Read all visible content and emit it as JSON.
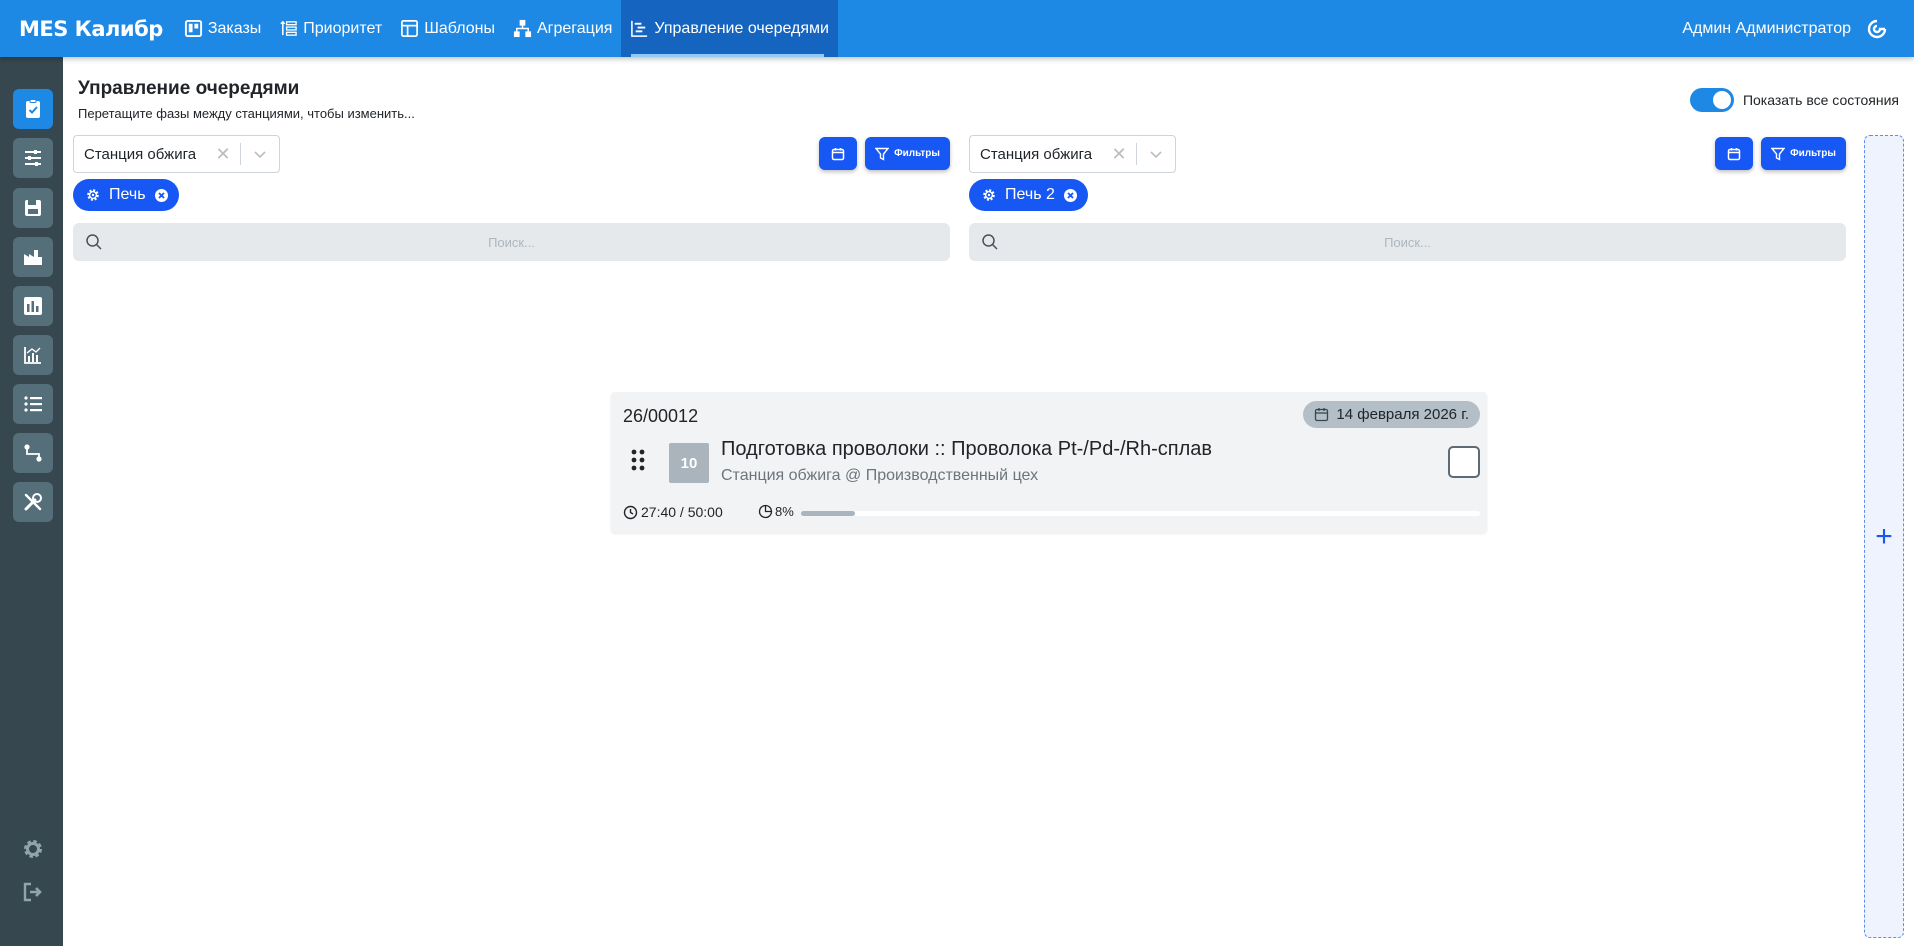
{
  "app": {
    "brand": "MES Калибр",
    "nav": [
      {
        "label": "Заказы",
        "icon": "board-icon"
      },
      {
        "label": "Приоритет",
        "icon": "priority-icon"
      },
      {
        "label": "Шаблоны",
        "icon": "template-icon"
      },
      {
        "label": "Агрегация",
        "icon": "aggregation-icon"
      },
      {
        "label": "Управление очередями",
        "icon": "queue-icon",
        "active": true
      }
    ],
    "user": "Админ Администратор",
    "accent": "#1e88e5",
    "button_color": "#1757f3"
  },
  "page": {
    "title": "Управление очередями",
    "subtitle": "Перетащите фазы между станциями, чтобы изменить...",
    "show_all_label": "Показать все состояния",
    "show_all_on": true
  },
  "columns": [
    {
      "station": "Станция обжига",
      "filter_label": "Фильтры",
      "chip": "Печь",
      "search_placeholder": "Поиск..."
    },
    {
      "station": "Станция обжига",
      "filter_label": "Фильтры",
      "chip": "Печь 2",
      "search_placeholder": "Поиск..."
    }
  ],
  "card": {
    "order_id": "26/00012",
    "date": "14 февраля 2026 г.",
    "number": "10",
    "title": "Подготовка проволоки :: Проволока Pt-/Pd-/Rh-сплав",
    "location": "Станция обжига @ Производственный цех",
    "time": "27:40 / 50:00",
    "progress_label": "8%",
    "progress": 0.08
  },
  "add_column": "+"
}
